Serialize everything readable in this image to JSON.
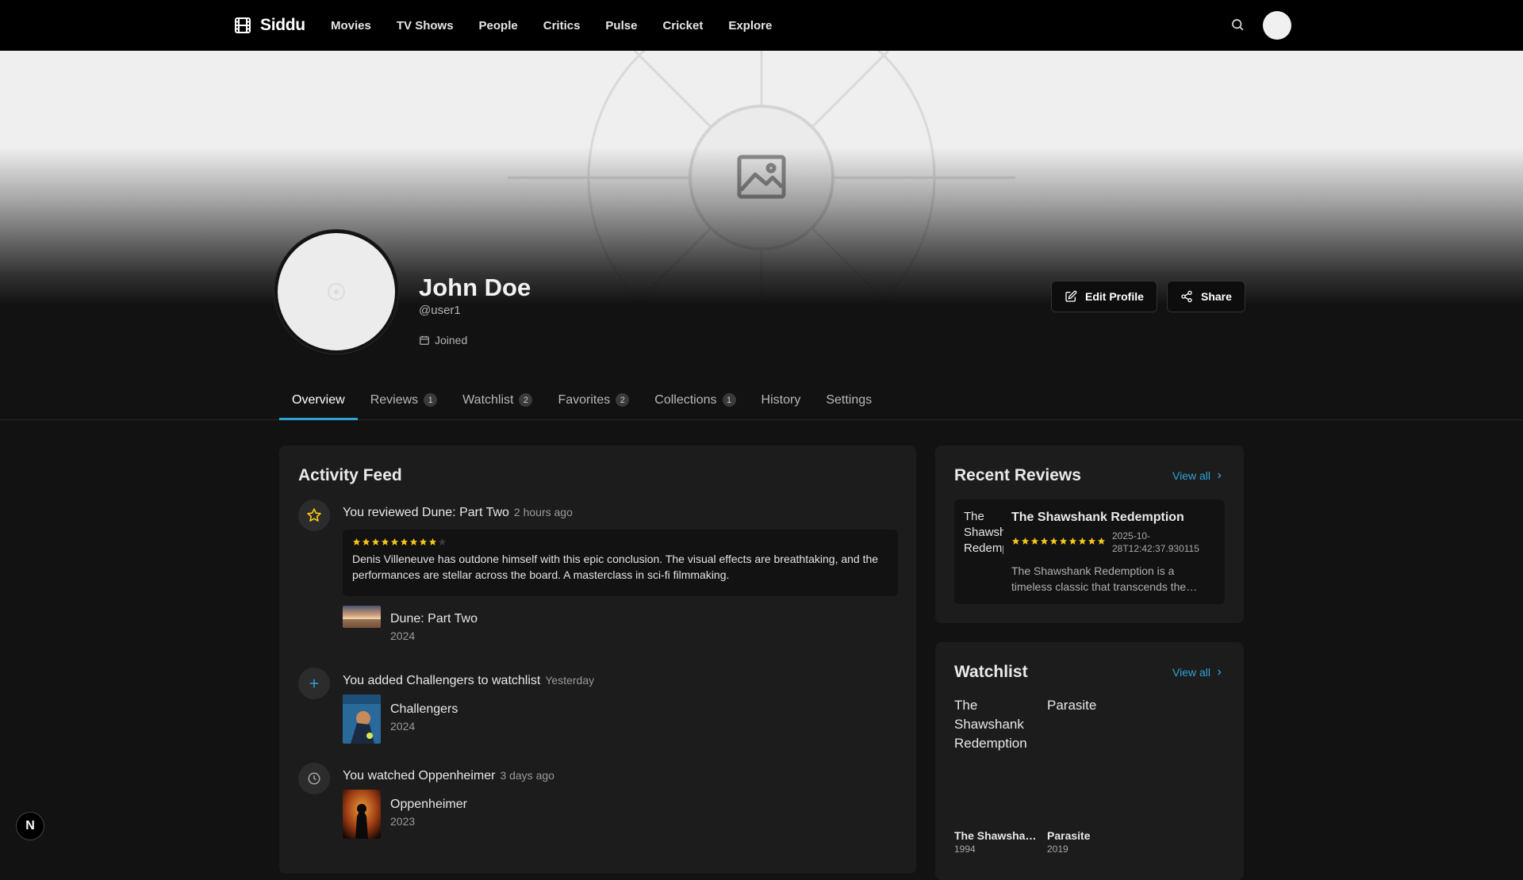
{
  "nav": {
    "logo": "Siddu",
    "links": [
      "Movies",
      "TV Shows",
      "People",
      "Critics",
      "Pulse",
      "Cricket",
      "Explore"
    ]
  },
  "profile": {
    "name": "John Doe",
    "handle": "@user1",
    "joined": "Joined",
    "edit_label": "Edit Profile",
    "share_label": "Share"
  },
  "tabs": [
    {
      "label": "Overview",
      "count": ""
    },
    {
      "label": "Reviews",
      "count": "1"
    },
    {
      "label": "Watchlist",
      "count": "2"
    },
    {
      "label": "Favorites",
      "count": "2"
    },
    {
      "label": "Collections",
      "count": "1"
    },
    {
      "label": "History",
      "count": ""
    },
    {
      "label": "Settings",
      "count": ""
    }
  ],
  "activity": {
    "title": "Activity Feed",
    "items": [
      {
        "icon": "star-icon",
        "text": "You reviewed Dune: Part Two",
        "time": "2 hours ago",
        "rating": 9,
        "review": "Denis Villeneuve has outdone himself with this epic conclusion. The visual effects are breathtaking, and the performances are stellar across the board. A masterclass in sci-fi filmmaking.",
        "film_title": "Dune: Part Two",
        "film_year": "2024"
      },
      {
        "icon": "plus-icon",
        "text": "You added Challengers to watchlist",
        "time": "Yesterday",
        "film_title": "Challengers",
        "film_year": "2024"
      },
      {
        "icon": "clock-icon",
        "text": "You watched Oppenheimer",
        "time": "3 days ago",
        "film_title": "Oppenheimer",
        "film_year": "2023"
      }
    ]
  },
  "recent_reviews": {
    "title": "Recent Reviews",
    "view_all": "View all",
    "item": {
      "poster_alt": "The Shawshank Redemption",
      "title": "The Shawshank Redemption",
      "rating": 10,
      "date": "2025-10-28T12:42:37.930115",
      "excerpt": "The Shawshank Redemption is a timeless classic that transcends the…"
    }
  },
  "watchlist": {
    "title": "Watchlist",
    "view_all": "View all",
    "items": [
      {
        "alt": "The Shawshank Redemption",
        "title": "The Shawshan…",
        "year": "1994"
      },
      {
        "alt": "Parasite",
        "title": "Parasite",
        "year": "2019"
      }
    ]
  },
  "badge": "N",
  "colors": {
    "accent": "#2fa4d6",
    "star": "#f5c518",
    "background": "#121212",
    "card": "#1c1c1c"
  }
}
